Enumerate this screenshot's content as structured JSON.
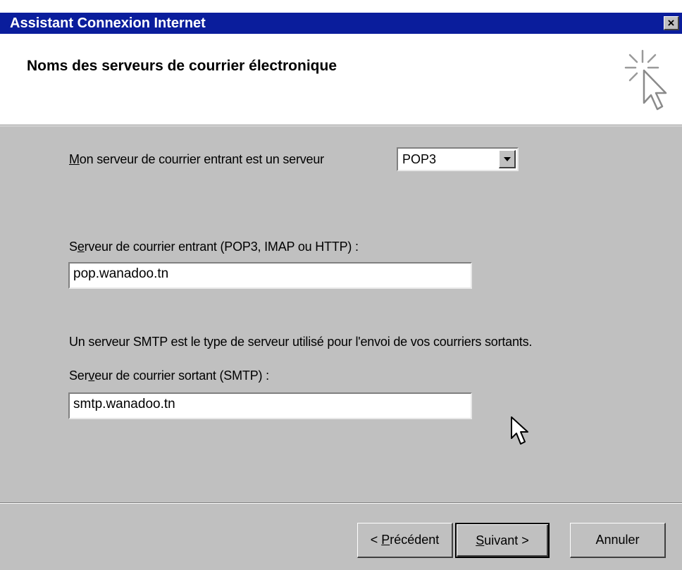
{
  "window": {
    "title": "Assistant Connexion Internet",
    "close_label": "×"
  },
  "header": {
    "title": "Noms des serveurs de courrier électronique",
    "icon": "wizard-sparkle-cursor-icon"
  },
  "server_type": {
    "label_accel": "M",
    "label_rest": "on serveur de courrier entrant est un serveur",
    "selected": "POP3"
  },
  "incoming": {
    "label_first": "S",
    "label_accel": "e",
    "label_rest": "rveur de courrier entrant (POP3, IMAP ou HTTP) :",
    "value": "pop.wanadoo.tn"
  },
  "smtp_info": "Un serveur SMTP est le type de serveur utilisé pour l'envoi de vos courriers sortants.",
  "outgoing": {
    "label_first": "Ser",
    "label_accel": "v",
    "label_rest": "eur de courrier sortant (SMTP) :",
    "value": "smtp.wanadoo.tn"
  },
  "buttons": {
    "back_prefix": "< ",
    "back_accel": "P",
    "back_rest": "récédent",
    "next_accel": "S",
    "next_rest": "uivant >",
    "cancel": "Annuler"
  }
}
